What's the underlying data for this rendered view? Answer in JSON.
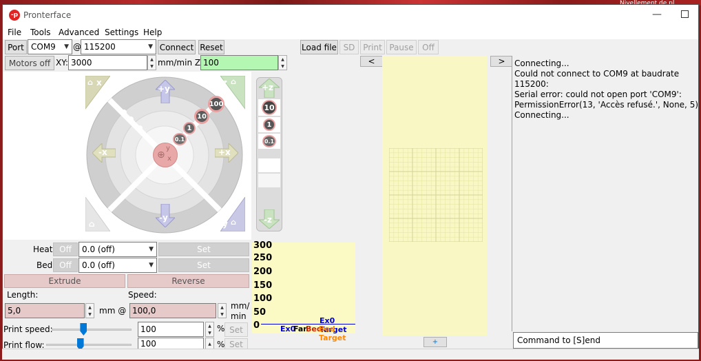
{
  "window": {
    "title": "Pronterface",
    "bg_fragment": "Nivellement de pl"
  },
  "menu": [
    "File",
    "Tools",
    "Advanced",
    "Settings",
    "Help"
  ],
  "connection": {
    "port_label": "Port",
    "port_value": "COM9",
    "at": "@",
    "baud_value": "115200",
    "connect_label": "Connect",
    "reset_label": "Reset"
  },
  "file_toolbar": {
    "load_file": "Load file",
    "sd": "SD",
    "print": "Print",
    "pause": "Pause",
    "off": "Off"
  },
  "motors": {
    "motors_off": "Motors off",
    "xy_label": "XY:",
    "xy_value": "3000",
    "z_unit_label": "mm/min Z:",
    "z_value": "100"
  },
  "jog": {
    "home_x": "x",
    "home_z": "z",
    "home_y": "y",
    "plus_y": "+y",
    "minus_y": "-y",
    "minus_x": "-x",
    "plus_x": "+x",
    "step_100": "100",
    "step_10": "10",
    "step_1": "1",
    "step_01": "0.1",
    "center_y": "y",
    "center_x": "x",
    "plus_z": "+z",
    "minus_z": "-z",
    "z_step_10": "10",
    "z_step_1": "1",
    "z_step_01": "0.1"
  },
  "temps": {
    "heat_label": "Heat:",
    "heat_off": "Off",
    "heat_value": "0.0 (off)",
    "heat_set": "Set",
    "bed_label": "Bed:",
    "bed_off": "Off",
    "bed_value": "0.0 (off)",
    "bed_set": "Set"
  },
  "extrude": {
    "extrude_label": "Extrude",
    "reverse_label": "Reverse",
    "length_label": "Length:",
    "speed_label": "Speed:",
    "length_value": "5,0",
    "length_unit": "mm @",
    "speed_value": "100,0",
    "speed_unit_1": "mm/",
    "speed_unit_2": "min"
  },
  "print_speed": {
    "label": "Print speed:",
    "value": "100",
    "pct": "%",
    "set": "Set",
    "level": 0.4
  },
  "print_flow": {
    "label": "Print flow:",
    "value": "100",
    "pct": "%",
    "set": "Set",
    "level": 0.4
  },
  "graph": {
    "ticks": [
      "300",
      "250",
      "200",
      "150",
      "100",
      "50",
      "0"
    ],
    "legend_target": "Ex0 Target",
    "legend_ex0": "Ex0",
    "legend_fan": "Fan",
    "legend_bed": "Bed",
    "legend_bed_target": "Bed Target",
    "colors": {
      "ex0": "#0000cc",
      "fan": "#000000",
      "bed": "#cc2200",
      "bed_target": "#ff8800"
    }
  },
  "nav": {
    "prev": "<",
    "next": ">",
    "plus": "+"
  },
  "log": {
    "lines": [
      "Connecting...",
      "Could not connect to COM9 at baudrate 115200:",
      "Serial error: could not open port 'COM9':",
      "PermissionError(13, 'Accès refusé.', None, 5)",
      "Connecting..."
    ]
  },
  "command": {
    "placeholder": "Command to [S]end"
  }
}
